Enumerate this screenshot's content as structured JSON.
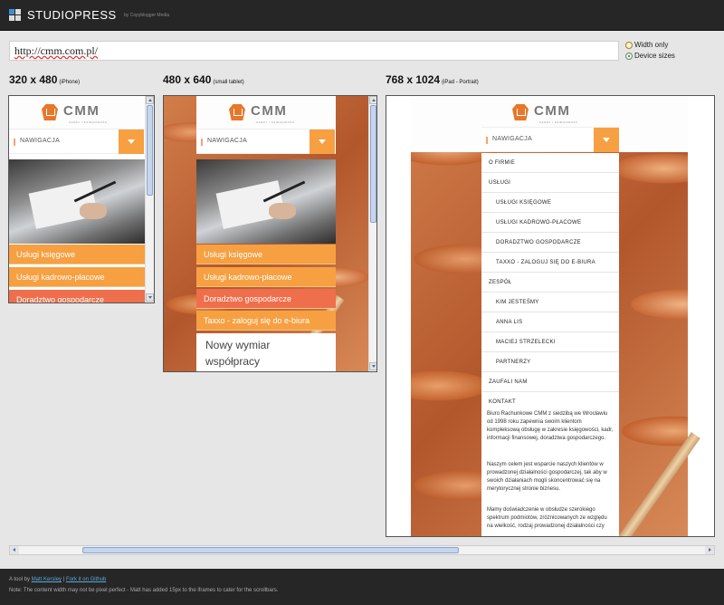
{
  "app": {
    "brand": "STUDIOPRESS",
    "tagline": "by Copyblogger Media"
  },
  "url": "http://cmm.com.pl/",
  "options": {
    "width_only": "Width only",
    "device_sizes": "Device sizes",
    "selected": "Device sizes"
  },
  "devices": [
    {
      "size": "320 x 480",
      "name": "(iPhone)"
    },
    {
      "size": "480 x 640",
      "name": "(small tablet)"
    },
    {
      "size": "768 x 1024",
      "name": "(iPad - Portrait)"
    }
  ],
  "site": {
    "logo_text": "CMM",
    "logo_sub": "KADRY I KSIĘGOWOŚĆ",
    "nav_label": "NAWIGACJA",
    "menu_buttons": [
      "Usługi księgowe",
      "Usługi kadrowo-płacowe",
      "Doradztwo gospodarcze",
      "Taxxo - zaloguj się do e-biura"
    ],
    "headline_line1": "Nowy wymiar",
    "headline_line2": "współpracy",
    "nav_menu": [
      {
        "label": "O FIRMIE",
        "level": 0
      },
      {
        "label": "USŁUGI",
        "level": 0
      },
      {
        "label": "USŁUGI KSIĘGOWE",
        "level": 1
      },
      {
        "label": "USŁUGI KADROWO-PŁACOWE",
        "level": 1
      },
      {
        "label": "DORADZTWO GOSPODARCZE",
        "level": 1
      },
      {
        "label": "TAXXO - ZALOGUJ SIĘ DO E-BIURA",
        "level": 1
      },
      {
        "label": "ZESPÓŁ",
        "level": 0
      },
      {
        "label": "KIM JESTEŚMY",
        "level": 1
      },
      {
        "label": "ANNA LIS",
        "level": 1
      },
      {
        "label": "MACIEJ STRZELECKI",
        "level": 1
      },
      {
        "label": "PARTNERZY",
        "level": 1
      },
      {
        "label": "ZAUFALI NAM",
        "level": 0
      },
      {
        "label": "KONTAKT",
        "level": 0
      }
    ],
    "paragraphs": [
      "Biuro Rachunkowe CMM z siedzibą we Wrocławiu od 1998 roku zapewnia swoim klientom kompleksową obsługę w zakresie księgowości, kadr, informacji finansowej, doradztwa gospodarczego.",
      "Naszym celem jest wsparcie naszych klientów w prowadzonej działalności gospodarczej, tak aby w swoich działaniach mogli skoncentrować się na merytorycznej stronie biznesu.",
      "Mamy doświadczenie w obsłudze szerokiego spektrum podmiotów, zróżnicowanych ze względu na wielkość, rodzaj prowadzonej działalności czy"
    ]
  },
  "footer": {
    "prefix": "A tool by",
    "author_link": "Matt Kersley",
    "sep": "|",
    "github_link": "Fork it on Github",
    "note": "Note: The content width may not be pixel perfect - Matt has added 15px to the iframes to cater for the scrollbars."
  },
  "colors": {
    "accent_orange": "#f6a042",
    "accent_red": "#ef6e4b",
    "topbar": "#262626",
    "link": "#5aa9d8"
  }
}
